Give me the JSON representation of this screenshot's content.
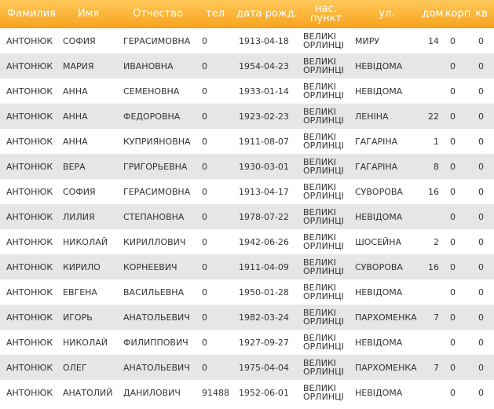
{
  "columns": [
    "Фамилия",
    "Имя",
    "Отчество",
    "тел",
    "дата рожд.",
    "нас. пункт",
    "ул.",
    "дом",
    "корп",
    "кв"
  ],
  "rows": [
    [
      "АНТОНЮК",
      "СОФИЯ",
      "ГЕРАСИМОВНА",
      "0",
      "1913-04-18",
      "ВЕЛИКІ ОРЛИНЦІ",
      "МИРУ",
      "14",
      "0",
      "0"
    ],
    [
      "АНТОНЮК",
      "МАРИЯ",
      "ИВАНОВНА",
      "0",
      "1954-04-23",
      "ВЕЛИКІ ОРЛИНЦІ",
      "НЕВІДОМА",
      "",
      "0",
      "0"
    ],
    [
      "АНТОНЮК",
      "АННА",
      "СЕМЕНОВНА",
      "0",
      "1933-01-14",
      "ВЕЛИКІ ОРЛИНЦІ",
      "НЕВІДОМА",
      "",
      "0",
      "0"
    ],
    [
      "АНТОНЮК",
      "АННА",
      "ФЕДОРОВНА",
      "0",
      "1923-02-23",
      "ВЕЛИКІ ОРЛИНЦІ",
      "ЛЕНІНА",
      "22",
      "0",
      "0"
    ],
    [
      "АНТОНЮК",
      "АННА",
      "КУПРИЯНОВНА",
      "0",
      "1911-08-07",
      "ВЕЛИКІ ОРЛИНЦІ",
      "ГАГАРІНА",
      "1",
      "0",
      "0"
    ],
    [
      "АНТОНЮК",
      "ВЕРА",
      "ГРИГОРЬЕВНА",
      "0",
      "1930-03-01",
      "ВЕЛИКІ ОРЛИНЦІ",
      "ГАГАРІНА",
      "8",
      "0",
      "0"
    ],
    [
      "АНТОНЮК",
      "СОФИЯ",
      "ГЕРАСИМОВНА",
      "0",
      "1913-04-17",
      "ВЕЛИКІ ОРЛИНЦІ",
      "СУВОРОВА",
      "16",
      "0",
      "0"
    ],
    [
      "АНТОНЮК",
      "ЛИЛИЯ",
      "СТЕПАНОВНА",
      "0",
      "1978-07-22",
      "ВЕЛИКІ ОРЛИНЦІ",
      "НЕВІДОМА",
      "",
      "0",
      "0"
    ],
    [
      "АНТОНЮК",
      "НИКОЛАЙ",
      "КИРИЛЛОВИЧ",
      "0",
      "1942-06-26",
      "ВЕЛИКІ ОРЛИНЦІ",
      "ШОСЕЙНА",
      "2",
      "0",
      "0"
    ],
    [
      "АНТОНЮК",
      "КИРИЛО",
      "КОРНЕЕВИЧ",
      "0",
      "1911-04-09",
      "ВЕЛИКІ ОРЛИНЦІ",
      "СУВОРОВА",
      "16",
      "0",
      "0"
    ],
    [
      "АНТОНЮК",
      "ЕВГЕНА",
      "ВАСИЛЬЕВНА",
      "0",
      "1950-01-28",
      "ВЕЛИКІ ОРЛИНЦІ",
      "НЕВІДОМА",
      "",
      "0",
      "0"
    ],
    [
      "АНТОНЮК",
      "ИГОРЬ",
      "АНАТОЛЬЕВИЧ",
      "0",
      "1982-03-24",
      "ВЕЛИКІ ОРЛИНЦІ",
      "ПАРХОМЕНКА",
      "7",
      "0",
      "0"
    ],
    [
      "АНТОНЮК",
      "НИКОЛАЙ",
      "ФИЛИППОВИЧ",
      "0",
      "1927-09-27",
      "ВЕЛИКІ ОРЛИНЦІ",
      "НЕВІДОМА",
      "",
      "0",
      "0"
    ],
    [
      "АНТОНЮК",
      "ОЛЕГ",
      "АНАТОЛЬЕВИЧ",
      "0",
      "1975-04-04",
      "ВЕЛИКІ ОРЛИНЦІ",
      "ПАРХОМЕНКА",
      "7",
      "0",
      "0"
    ],
    [
      "АНТОНЮК",
      "АНАТОЛИЙ",
      "ДАНИЛОВИЧ",
      "91488",
      "1952-06-01",
      "ВЕЛИКІ ОРЛИНЦІ",
      "НЕВІДОМА",
      "",
      "0",
      "0"
    ]
  ]
}
